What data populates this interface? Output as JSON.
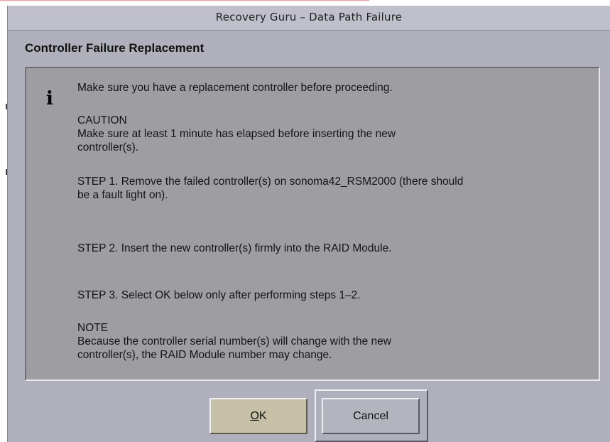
{
  "window": {
    "title": "Recovery Guru – Data Path Failure"
  },
  "heading": "Controller Failure Replacement",
  "message": {
    "icon": "info-icon",
    "icon_glyph": "i",
    "lines": [
      "Make sure you have a replacement controller before proceeding.",
      "CAUTION",
      "Make sure at least 1 minute has elapsed before inserting the new",
      "controller(s).",
      "STEP 1. Remove the failed controller(s) on sonoma42_RSM2000 (there should",
      "be a fault light on).",
      "STEP 2.  Insert the new controller(s) firmly into the RAID Module.",
      "STEP 3.  Select OK below only after performing steps 1–2.",
      "NOTE",
      "Because the controller serial number(s) will change with the new",
      "controller(s), the RAID Module number may change."
    ]
  },
  "buttons": {
    "ok_mnemonic": "O",
    "ok_rest": "K",
    "cancel_label": "Cancel"
  }
}
